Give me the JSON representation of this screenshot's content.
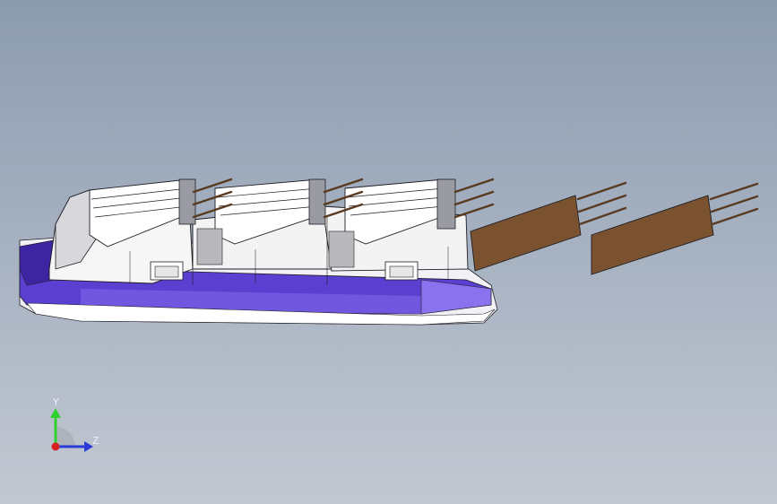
{
  "viewport": {
    "background_top": "#8c9bae",
    "background_bottom": "#c2c8d2"
  },
  "model": {
    "colors": {
      "base_purple": "#6a4bd8",
      "base_purple_dark": "#3a2590",
      "base_white": "#f4f4f8",
      "body_white": "#f7f7f7",
      "copper": "#7a5230",
      "copper_light": "#a7774b",
      "outline": "#1e1e24"
    }
  },
  "triad": {
    "axes": [
      {
        "label": "Y",
        "color": "#2fd02f",
        "icon": "y-axis-arrow-icon"
      },
      {
        "label": "Z",
        "color": "#2a3bd6",
        "icon": "z-axis-arrow-icon"
      },
      {
        "label": "",
        "color": "#d82020",
        "icon": "x-axis-dot-icon"
      }
    ]
  }
}
